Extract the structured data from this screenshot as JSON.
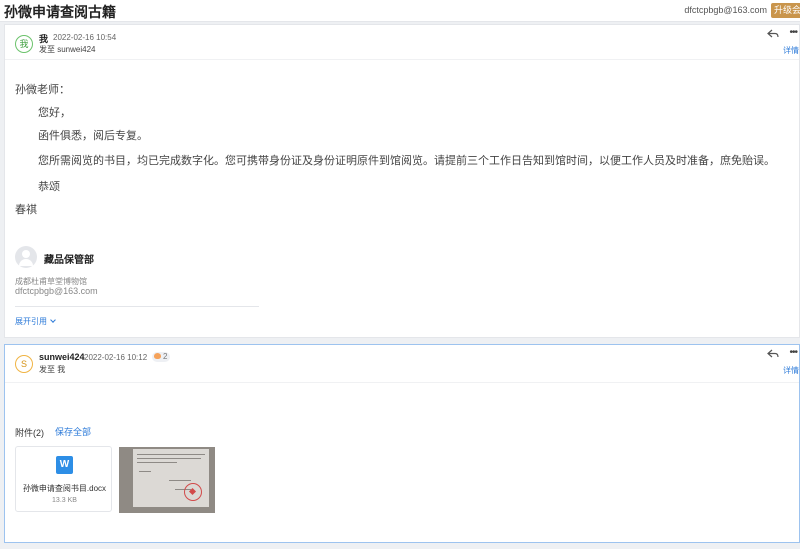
{
  "header": {
    "subject": "孙微申请查阅古籍",
    "account": "dfctcpbgb@163.com",
    "upgrade_label": "升级会员"
  },
  "message1": {
    "avatar_text": "我",
    "sender": "我",
    "date": "2022-02-16 10:54",
    "to": "发至 sunwei424",
    "detail_label": "详情",
    "body": {
      "greeting": "孙微老师：",
      "line1": "您好，",
      "line2": "函件俱悉，阅后专复。",
      "line3": "您所需阅览的书目，均已完成数字化。您可携带身份证及身份证明原件到馆阅览。请提前三个工作日告知到馆时间，以便工作人员及时准备，庶免贻误。",
      "closing1": "恭颂",
      "closing2": "春祺"
    },
    "signature": {
      "name": "藏品保管部",
      "org": "成都杜甫草堂博物馆",
      "email": "dfctcpbgb@163.com"
    },
    "expand_label": "展开引用"
  },
  "message2": {
    "avatar_text": "S",
    "sender": "sunwei424",
    "date": "2022-02-16 10:12",
    "badge_count": "2",
    "to": "发至 我",
    "detail_label": "详情",
    "attachments_label": "附件(2)",
    "save_all_label": "保存全部",
    "file": {
      "icon_letter": "W",
      "name": "孙微申请查阅书目.docx",
      "size": "13.3 KB"
    }
  },
  "colors": {
    "accent": "#2e7bd9",
    "upgrade": "#c9954c",
    "word": "#2d8ee6"
  }
}
